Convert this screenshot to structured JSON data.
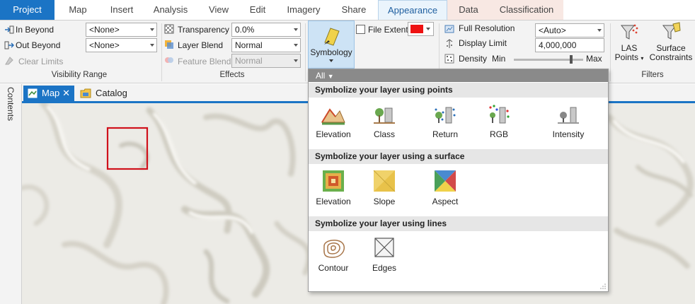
{
  "ribbon_tabs": [
    "Project",
    "Map",
    "Insert",
    "Analysis",
    "View",
    "Edit",
    "Imagery",
    "Share",
    "Appearance",
    "Data",
    "Classification"
  ],
  "visibility_range": {
    "in_beyond_label": "In Beyond",
    "in_beyond_value": "<None>",
    "out_beyond_label": "Out Beyond",
    "out_beyond_value": "<None>",
    "clear_limits_label": "Clear Limits",
    "group_label": "Visibility Range"
  },
  "effects": {
    "transparency_label": "Transparency",
    "transparency_value": "0.0%",
    "layer_blend_label": "Layer Blend",
    "layer_blend_value": "Normal",
    "feature_blend_label": "Feature Blend",
    "feature_blend_value": "Normal",
    "group_label": "Effects"
  },
  "drawing": {
    "symbology_label": "Symbology",
    "file_extent_label": "File Extent",
    "file_extent_color": "#ee1111"
  },
  "display": {
    "full_resolution_label": "Full Resolution",
    "full_resolution_value": "<Auto>",
    "display_limit_label": "Display Limit",
    "display_limit_value": "4,000,000",
    "density_label": "Density",
    "density_min": "Min",
    "density_max": "Max",
    "density_level": 0.83
  },
  "filters": {
    "las_points_line1": "LAS",
    "las_points_line2": "Points",
    "surface_constraints_line1": "Surface",
    "surface_constraints_line2": "Constraints",
    "group_label": "Filters"
  },
  "contents_label": "Contents",
  "view_tabs": {
    "map": "Map",
    "catalog": "Catalog"
  },
  "gallery": {
    "filter_label": "All",
    "points_header": "Symbolize your layer using points",
    "points_items": [
      "Elevation",
      "Class",
      "Return",
      "RGB",
      "Intensity"
    ],
    "surface_header": "Symbolize your layer using a surface",
    "surface_items": [
      "Elevation",
      "Slope",
      "Aspect"
    ],
    "lines_header": "Symbolize your layer using lines",
    "lines_items": [
      "Contour",
      "Edges"
    ]
  },
  "colors": {
    "accent": "#1b74c5",
    "active_tab_bg": "#eaf4fc",
    "context_tab_bg": "#f8e8e3",
    "highlight_rect": "#d0111b"
  },
  "icons": [
    "in-beyond-icon",
    "out-beyond-icon",
    "clear-limits-icon",
    "transparency-icon",
    "layer-blend-icon",
    "feature-blend-icon",
    "symbology-icon",
    "full-resolution-icon",
    "display-limit-icon",
    "density-icon",
    "las-filter-icon",
    "surface-constraints-icon",
    "map-icon",
    "catalog-icon"
  ]
}
